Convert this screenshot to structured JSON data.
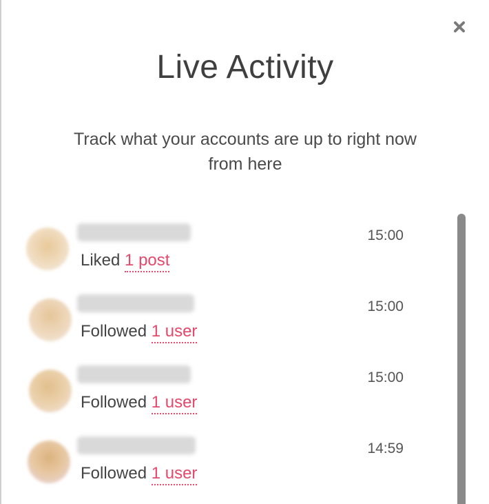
{
  "header": {
    "title": "Live Activity",
    "subtitle": "Track what your accounts are up to right now from here",
    "close_icon": "close-icon"
  },
  "colors": {
    "link": "#e5486a",
    "title": "#3f3f3f",
    "scrollbar": "#8a8a8a"
  },
  "feed": {
    "items": [
      {
        "action": "Liked",
        "target": "1 post",
        "time": "15:00"
      },
      {
        "action": "Followed",
        "target": "1 user",
        "time": "15:00"
      },
      {
        "action": "Followed",
        "target": "1 user",
        "time": "15:00"
      },
      {
        "action": "Followed",
        "target": "1 user",
        "time": "14:59"
      }
    ]
  }
}
